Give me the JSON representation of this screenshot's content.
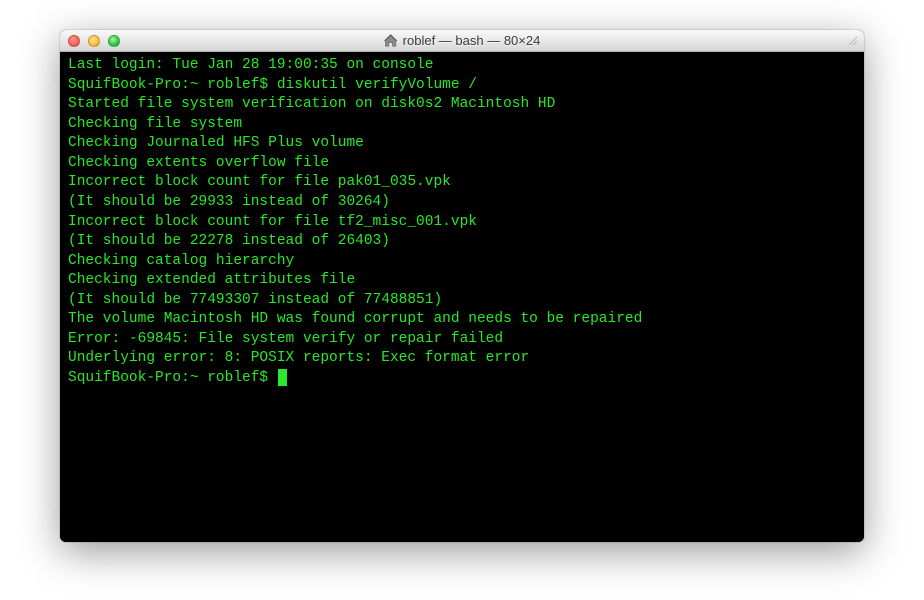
{
  "window": {
    "title": "roblef — bash — 80×24",
    "home_icon": "home-icon"
  },
  "terminal": {
    "text_color": "#29e729",
    "background_color": "#000000",
    "lines": [
      "Last login: Tue Jan 28 19:00:35 on console",
      "SquifBook-Pro:~ roblef$ diskutil verifyVolume /",
      "Started file system verification on disk0s2 Macintosh HD",
      "Checking file system",
      "Checking Journaled HFS Plus volume",
      "Checking extents overflow file",
      "Incorrect block count for file pak01_035.vpk",
      "(It should be 29933 instead of 30264)",
      "Incorrect block count for file tf2_misc_001.vpk",
      "(It should be 22278 instead of 26403)",
      "Checking catalog hierarchy",
      "Checking extended attributes file",
      "(It should be 77493307 instead of 77488851)",
      "The volume Macintosh HD was found corrupt and needs to be repaired",
      "Error: -69845: File system verify or repair failed",
      "Underlying error: 8: POSIX reports: Exec format error"
    ],
    "prompt": "SquifBook-Pro:~ roblef$ "
  }
}
